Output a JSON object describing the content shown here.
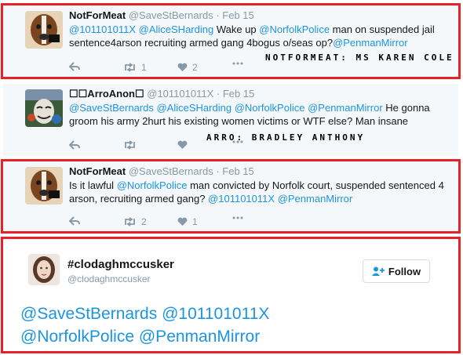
{
  "tweets": [
    {
      "name": "NotForMeat",
      "handle": "@SaveStBernards",
      "sep": "·",
      "date": "Feb 15",
      "text": [
        "@101101011X",
        " ",
        "@AliceSHarding",
        " Wake up ",
        "@NorfolkPolice",
        " man on suspended jail sentence4arson recruiting armed gang 4bogus o/seas op?",
        "@PenmanMirror"
      ],
      "reply_count": "",
      "retweet_count": "1",
      "like_count": "2",
      "stamp": "NOTFORMEAT: MS KAREN COLE"
    },
    {
      "name": "☐☐ArroAnon☐",
      "handle": "@101101011X",
      "sep": "·",
      "date": "Feb 15",
      "text": [
        "@SaveStBernards",
        " ",
        "@AliceSHarding",
        " ",
        "@NorfolkPolice",
        " ",
        "@PenmanMirror",
        " He gonna groom his army 2hurt his existing women victims or WTF else? Man insane"
      ],
      "reply_count": "",
      "retweet_count": "",
      "like_count": "",
      "stamp": "ARRO: BRADLEY ANTHONY"
    },
    {
      "name": "NotForMeat",
      "handle": "@SaveStBernards",
      "sep": "·",
      "date": "Feb 15",
      "text": [
        "Is it lawful ",
        "@NorfolkPolice",
        " man convicted by Norfolk court, suspended sentenced 4 arson, recruiting armed gang? ",
        "@101101011X",
        "  ",
        "@PenmanMirror"
      ],
      "reply_count": "",
      "retweet_count": "2",
      "like_count": "1",
      "stamp": ""
    }
  ],
  "profile": {
    "name": "#clodaghmccusker",
    "handle": "@clodaghmccusker",
    "follow_label": "Follow",
    "big_text_line1": "@SaveStBernards @101101011X",
    "big_text_line2": "@NorfolkPolice @PenmanMirror"
  },
  "colors": {
    "frame": "#e8202a",
    "link": "#1b95e0",
    "muted": "#8899a6",
    "bg": "#f5f8fa"
  },
  "icons": [
    "reply-icon",
    "retweet-icon",
    "heart-icon",
    "more-icon",
    "follow-person-icon"
  ]
}
